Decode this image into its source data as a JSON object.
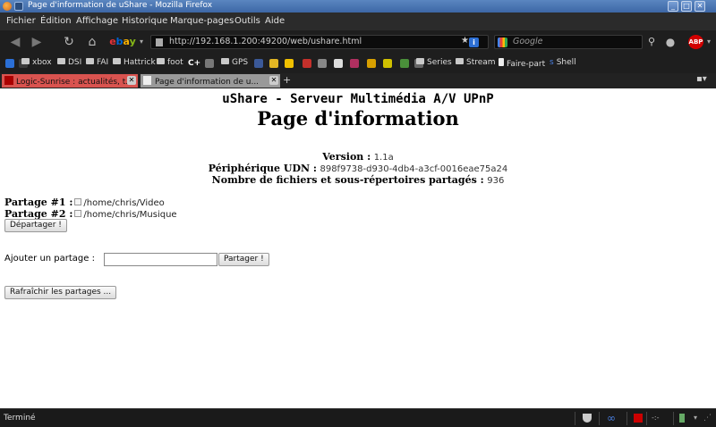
{
  "window": {
    "title": "Page d'information de uShare - Mozilla Firefox",
    "controls": [
      "_",
      "□",
      "✕"
    ]
  },
  "menu": [
    "Fichier",
    "Édition",
    "Affichage",
    "Historique",
    "Marque-pages",
    "Outils",
    "Aide"
  ],
  "navigation": {
    "url": "http://192.168.1.200:49200/web/ushare.html",
    "search_placeholder": "Google"
  },
  "bookmarks": [
    {
      "label": "xbox",
      "type": "folder"
    },
    {
      "label": "DSI",
      "type": "folder"
    },
    {
      "label": "FAI",
      "type": "folder"
    },
    {
      "label": "Hattrick",
      "type": "folder"
    },
    {
      "label": "foot",
      "type": "folder"
    },
    {
      "label": "GPS",
      "type": "folder"
    },
    {
      "label": "Series",
      "type": "folder"
    },
    {
      "label": "Stream",
      "type": "folder"
    },
    {
      "label": "Faire-part",
      "type": "page"
    },
    {
      "label": "Shell",
      "type": "link"
    }
  ],
  "tabs": [
    {
      "label": "Logic-Sunrise : actualités, t...",
      "active": false
    },
    {
      "label": "Page d'information de u...",
      "active": true
    }
  ],
  "page": {
    "subtitle": "uShare - Serveur Multimédia A/V UPnP",
    "title": "Page d'information",
    "version_label": "Version :",
    "version_value": "1.1a",
    "udn_label": "Périphérique UDN :",
    "udn_value": "898f9738-d930-4db4-a3cf-0016eae75a24",
    "count_label": "Nombre de fichiers et sous-répertoires partagés :",
    "count_value": "936",
    "shares": [
      {
        "label": "Partage #1 :",
        "path": "/home/chris/Video"
      },
      {
        "label": "Partage #2 :",
        "path": "/home/chris/Musique"
      }
    ],
    "unshare_button": "Départager !",
    "add_label": "Ajouter un partage :",
    "add_input_value": "",
    "share_button": "Partager !",
    "refresh_button": "Rafraîchir les partages ..."
  },
  "status": {
    "text": "Terminé",
    "widget_text": "-:-"
  }
}
